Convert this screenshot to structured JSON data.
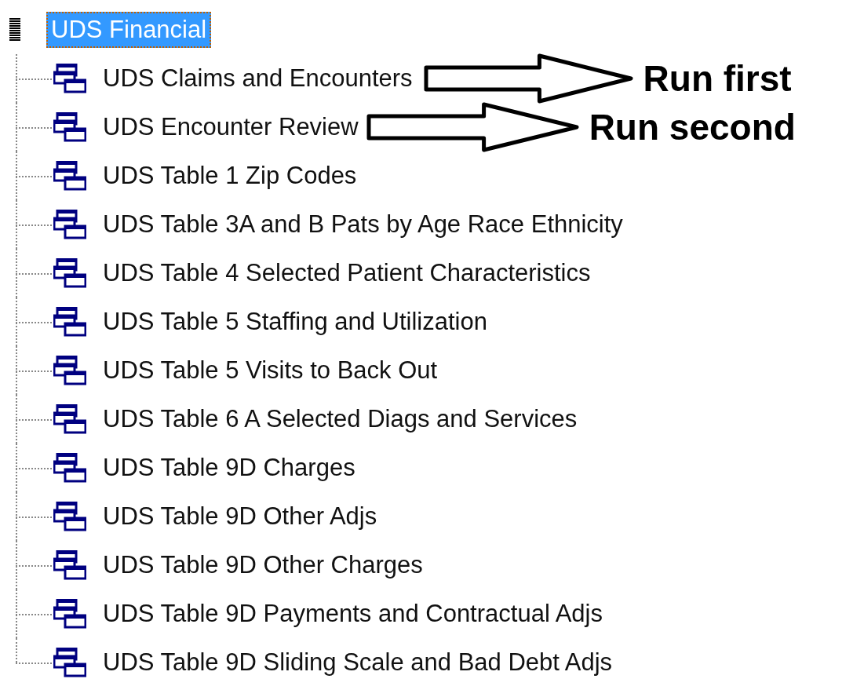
{
  "tree": {
    "label": "UDS Financial",
    "selected": true,
    "children": [
      {
        "label": "UDS Claims and Encounters",
        "selected": false,
        "annotation": "Run first"
      },
      {
        "label": "UDS Encounter Review",
        "selected": false,
        "annotation": "Run second"
      },
      {
        "label": "UDS Table 1 Zip Codes",
        "selected": false
      },
      {
        "label": "UDS Table 3A and B Pats by Age Race Ethnicity",
        "selected": false
      },
      {
        "label": "UDS Table 4 Selected Patient Characteristics",
        "selected": false
      },
      {
        "label": "UDS Table 5 Staffing and Utilization",
        "selected": false
      },
      {
        "label": "UDS Table 5 Visits to Back Out",
        "selected": false
      },
      {
        "label": "UDS Table 6 A Selected Diags and Services",
        "selected": false
      },
      {
        "label": "UDS Table 9D Charges",
        "selected": false
      },
      {
        "label": "UDS Table 9D Other Adjs",
        "selected": false
      },
      {
        "label": "UDS Table 9D Other Charges",
        "selected": false
      },
      {
        "label": "UDS Table 9D Payments and Contractual Adjs",
        "selected": false
      },
      {
        "label": "UDS Table 9D Sliding Scale and Bad Debt Adjs",
        "selected": false
      }
    ]
  }
}
